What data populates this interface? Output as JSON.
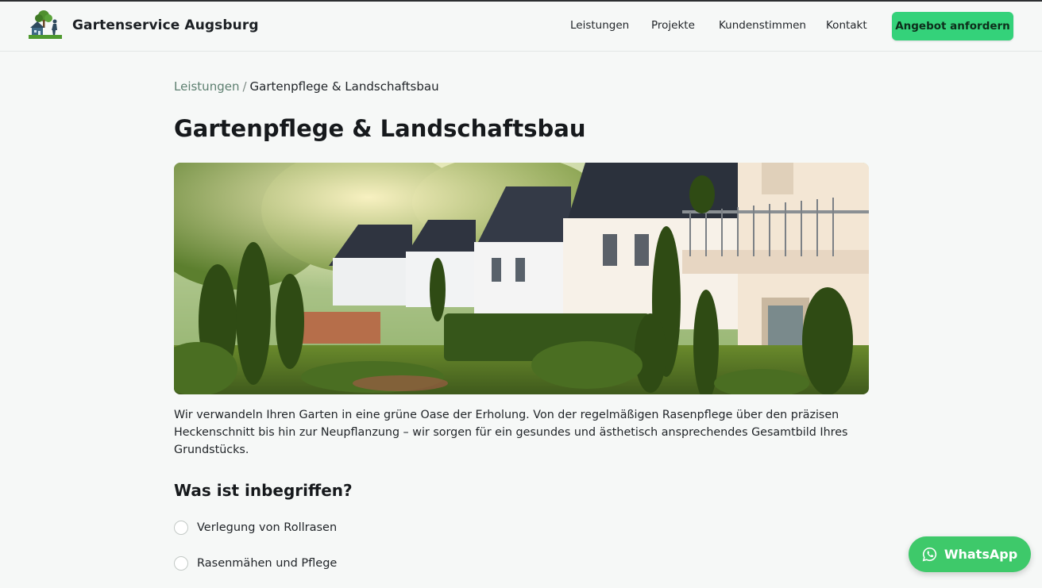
{
  "header": {
    "brand": "Gartenservice Augsburg",
    "nav": [
      "Leistungen",
      "Projekte",
      "Kundenstimmen",
      "Kontakt"
    ],
    "cta_label": "Angebot anfordern"
  },
  "breadcrumb": {
    "parent": "Leistungen",
    "separator": "/",
    "current": "Gartenpflege & Landschaftsbau"
  },
  "page": {
    "title": "Gartenpflege & Landschaftsbau",
    "intro": "Wir verwandeln Ihren Garten in eine grüne Oase der Erholung. Von der regelmäßigen Rasenpflege über den präzisen Heckenschnitt bis hin zur Neupflanzung – wir sorgen für ein gesundes und ästhetisch ansprechendes Gesamtbild Ihres Grundstücks.",
    "included_heading": "Was ist inbegriffen?",
    "included_items": [
      "Verlegung von Rollrasen",
      "Rasenmähen und Pflege"
    ]
  },
  "whatsapp": {
    "label": "WhatsApp",
    "icon": "whatsapp-icon"
  },
  "colors": {
    "accent": "#34d27a",
    "whatsapp": "#3ec96a",
    "breadcrumb_link": "#5d7f70"
  }
}
